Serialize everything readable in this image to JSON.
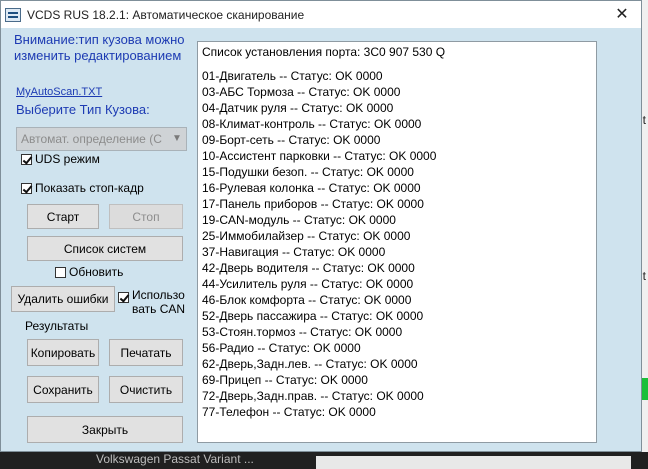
{
  "window": {
    "title": "VCDS RUS 18.2.1:  Автоматическое сканирование",
    "close_glyph": "✕"
  },
  "left_panel": {
    "notice": "Внимание:тип кузова можно изменить редактированием",
    "file_link": "MyAutoScan.TXT",
    "body_type_label": "Выберите Тип Кузова:",
    "body_type_select": "Автомат. определение (C",
    "uds_mode_label": "UDS режим",
    "uds_mode_checked": true,
    "show_freeze_label": "Показать стоп-кадр",
    "show_freeze_checked": true,
    "start_label": "Старт",
    "stop_label": "Стоп",
    "system_list_label": "Список систем",
    "refresh_label": "Обновить",
    "refresh_checked": false,
    "clear_errors_label": "Удалить ошибки",
    "use_can_label_1": "Использо",
    "use_can_label_2": "вать CAN",
    "use_can_checked": true,
    "results_label": "Результаты",
    "copy_label": "Копировать",
    "print_label": "Печатать",
    "save_label": "Сохранить",
    "clear_label": "Очистить",
    "close_label": "Закрыть"
  },
  "output": {
    "header": "Список установления порта:  3C0 907 530 Q",
    "lines": [
      "01-Двигатель -- Статус: OK 0000",
      "03-АБС Тормоза -- Статус: OK 0000",
      "04-Датчик руля -- Статус: OK 0000",
      "08-Климат-контроль -- Статус: OK 0000",
      "09-Борт-сеть -- Статус: OK 0000",
      "10-Ассистент парковки -- Статус: OK 0000",
      "15-Подушки безоп. -- Статус: OK 0000",
      "16-Рулевая колонка -- Статус: OK 0000",
      "17-Панель приборов -- Статус: OK 0000",
      "19-CAN-модуль -- Статус: OK 0000",
      "25-Иммобилайзер -- Статус: OK 0000",
      "37-Навигация -- Статус: OK 0000",
      "42-Дверь водителя -- Статус: OK 0000",
      "44-Усилитель руля -- Статус: OK 0000",
      "46-Блок комфорта -- Статус: OK 0000",
      "52-Дверь пассажира -- Статус: OK 0000",
      "53-Стоян.тормоз -- Статус: OK 0000",
      "56-Радио -- Статус: OK 0000",
      "62-Дверь,Задн.лев. -- Статус: OK 0000",
      "69-Прицеп -- Статус: OK 0000",
      "72-Дверь,Задн.прав. -- Статус: OK 0000",
      "77-Телефон -- Статус: OK 0000"
    ]
  },
  "background": {
    "fragment_1": "t",
    "fragment_2": "t",
    "taskbar_text": "Volkswagen Passat Variant ..."
  }
}
